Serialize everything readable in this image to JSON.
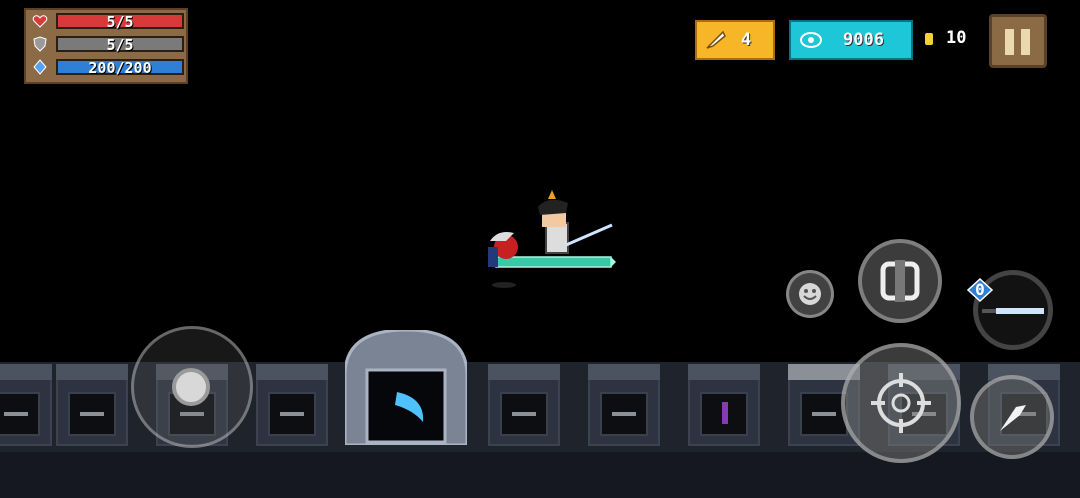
{
  "status": {
    "health": {
      "text": "5/5",
      "current": 5,
      "max": 5,
      "color": "#d83a3a"
    },
    "armor": {
      "text": "5/5",
      "current": 5,
      "max": 5,
      "color": "#7a7a7a"
    },
    "energy": {
      "text": "200/200",
      "current": 200,
      "max": 200,
      "color": "#2f7fd6"
    }
  },
  "currency": {
    "materials": "4",
    "gems": "9006",
    "coins": "10"
  },
  "weapon": {
    "energy_cost": "0"
  },
  "colors": {
    "panel": "#8c6a46",
    "materials": "#f6b628",
    "gems": "#1ec7d8",
    "coin": "#f3d13a"
  },
  "icons": [
    "heart-icon",
    "shield-icon",
    "energy-gem-icon",
    "feather-icon",
    "gem-eye-icon",
    "coin-icon",
    "pause-icon",
    "smiley-icon",
    "swap-skill-icon",
    "crosshair-icon",
    "dash-icon"
  ]
}
